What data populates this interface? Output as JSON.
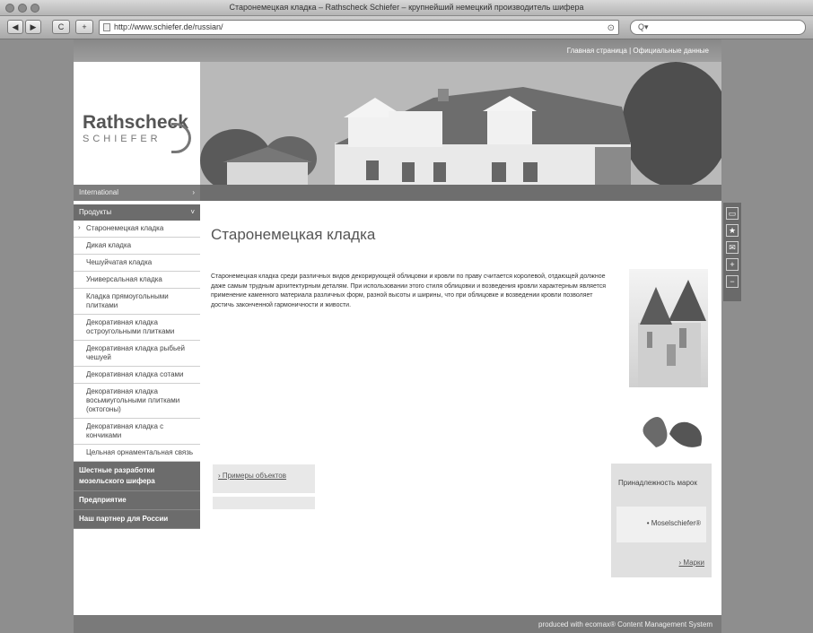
{
  "browser": {
    "window_title": "Старонемецкая кладка – Rathscheck Schiefer – крупнейший немецкий производитель шифера",
    "url": "http://www.schiefer.de/russian/",
    "back": "◀",
    "forward": "▶",
    "reload": "C",
    "add": "+",
    "search_placeholder": "Q▾"
  },
  "topnav": {
    "home": "Главная страница",
    "separator": " | ",
    "official": "Официальные данные"
  },
  "logo": {
    "name": "Rathscheck",
    "sub": "SCHIEFER"
  },
  "sidebar": {
    "international": "International",
    "section": "Продукты",
    "items": [
      {
        "label": "Старонемецкая кладка"
      },
      {
        "label": "Дикая кладка"
      },
      {
        "label": "Чешуйчатая кладка"
      },
      {
        "label": "Универсальная кладка"
      },
      {
        "label": "Кладка прямоугольными плитками"
      },
      {
        "label": "Декоративная кладка остроугольными плитками"
      },
      {
        "label": "Декоративная кладка рыбьей чешуей"
      },
      {
        "label": "Декоративная кладка сотами"
      },
      {
        "label": "Декоративная кладка восьмиугольными плитками (октогоны)"
      },
      {
        "label": "Декоративная кладка с кончиками"
      },
      {
        "label": "Цельная орнаментальная связь"
      }
    ],
    "bottom": [
      {
        "label": "Шестные разработки мозельского шифера"
      },
      {
        "label": "Предприятие"
      },
      {
        "label": "Наш партнер для России"
      }
    ]
  },
  "content": {
    "title": "Старонемецкая кладка",
    "paragraph": "Старонемецкая кладка среди различных видов декорирующей облицовки и кровли по праву считается королевой, отдающей должное даже самым трудным архитектурным деталям. При использовании этого стиля облицовки и возведения кровли характерным является применение каменного материала различных форм, разной высоты и ширины, что при облицовке и возведении кровли позволяет достичь законченной гармоничности и живости.",
    "examples_link": "› Примеры объектов"
  },
  "box": {
    "title": "Принадлежность марок",
    "item": "• Moselschiefer®",
    "link": "› Марки"
  },
  "footer": {
    "text": "produced with ecomax®   Content Management System"
  },
  "sidetools": [
    "print-icon",
    "star-icon",
    "mail-icon",
    "plus-icon",
    "minus-icon"
  ]
}
